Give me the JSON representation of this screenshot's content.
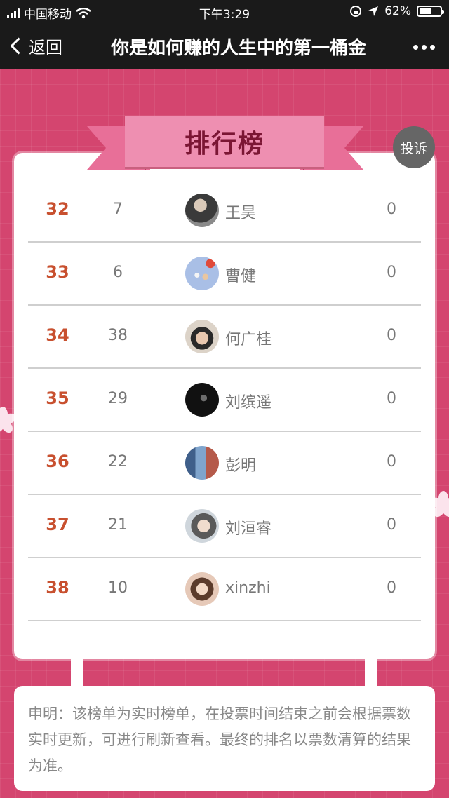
{
  "status_bar": {
    "carrier": "中国移动",
    "time": "下午3:29",
    "battery": "62%",
    "battery_level": 0.62
  },
  "nav": {
    "back_label": "返回",
    "title": "你是如何赚的人生中的第一桶金"
  },
  "ribbon_title": "排行榜",
  "complain_label": "投诉",
  "rows": [
    {
      "rank": "32",
      "num": "7",
      "name": "王昊",
      "score": "0"
    },
    {
      "rank": "33",
      "num": "6",
      "name": "曹健",
      "score": "0"
    },
    {
      "rank": "34",
      "num": "38",
      "name": "何广桂",
      "score": "0"
    },
    {
      "rank": "35",
      "num": "29",
      "name": "刘缤遥",
      "score": "0"
    },
    {
      "rank": "36",
      "num": "22",
      "name": "彭明",
      "score": "0"
    },
    {
      "rank": "37",
      "num": "21",
      "name": "刘洹睿",
      "score": "0"
    },
    {
      "rank": "38",
      "num": "10",
      "name": "xinzhi",
      "score": "0"
    }
  ],
  "notice": "申明：该榜单为实时榜单，在投票时间结束之前会根据票数实时更新，可进行刷新查看。最终的排名以票数清算的结果为准。",
  "colors": {
    "background": "#d4456f",
    "rank": "#c8502f",
    "ribbon": "#ee8fb1"
  }
}
